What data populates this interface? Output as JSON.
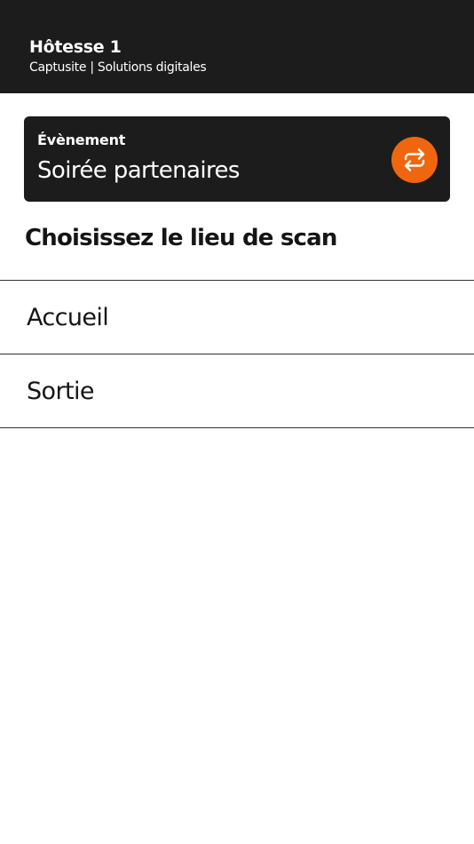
{
  "header": {
    "title": "Hôtesse 1",
    "subtitle": "Captusite | Solutions digitales"
  },
  "event": {
    "label": "Évènement",
    "name": "Soirée partenaires",
    "switch_icon": "swap-arrows-icon",
    "accent_color": "#f0660f"
  },
  "locations": {
    "heading": "Choisissez le lieu de scan",
    "items": [
      {
        "label": "Accueil"
      },
      {
        "label": "Sortie"
      }
    ]
  },
  "colors": {
    "dark_background": "#1c1c1c",
    "page_background": "#ffffff",
    "divider": "#333333"
  }
}
